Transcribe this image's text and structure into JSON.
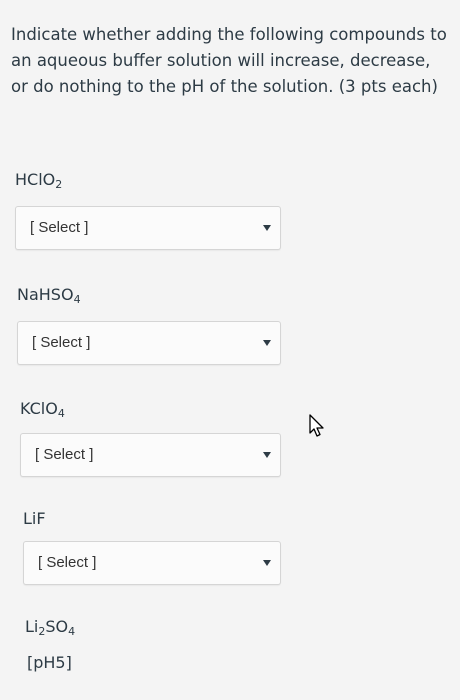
{
  "question": {
    "text": "Indicate whether adding the following compounds to an aqueous buffer solution will increase, decrease, or do nothing to the pH of the solution. (3 pts each)"
  },
  "items": [
    {
      "formula_parts": [
        "HClO",
        "2",
        ""
      ],
      "select_value": "[ Select ]"
    },
    {
      "formula_parts": [
        "NaHSO",
        "4",
        ""
      ],
      "select_value": "[ Select ]"
    },
    {
      "formula_parts": [
        "KClO",
        "4",
        ""
      ],
      "select_value": "[ Select ]"
    },
    {
      "formula_parts": [
        "LiF",
        "",
        ""
      ],
      "select_value": "[ Select ]"
    },
    {
      "formula_parts": [
        "Li",
        "2",
        "SO"
      ],
      "formula_tail_sub": "4"
    }
  ],
  "partial_text": "[pH5]",
  "icons": {
    "cursor": "mouse-pointer-icon",
    "dropdown": "caret-down-icon"
  }
}
